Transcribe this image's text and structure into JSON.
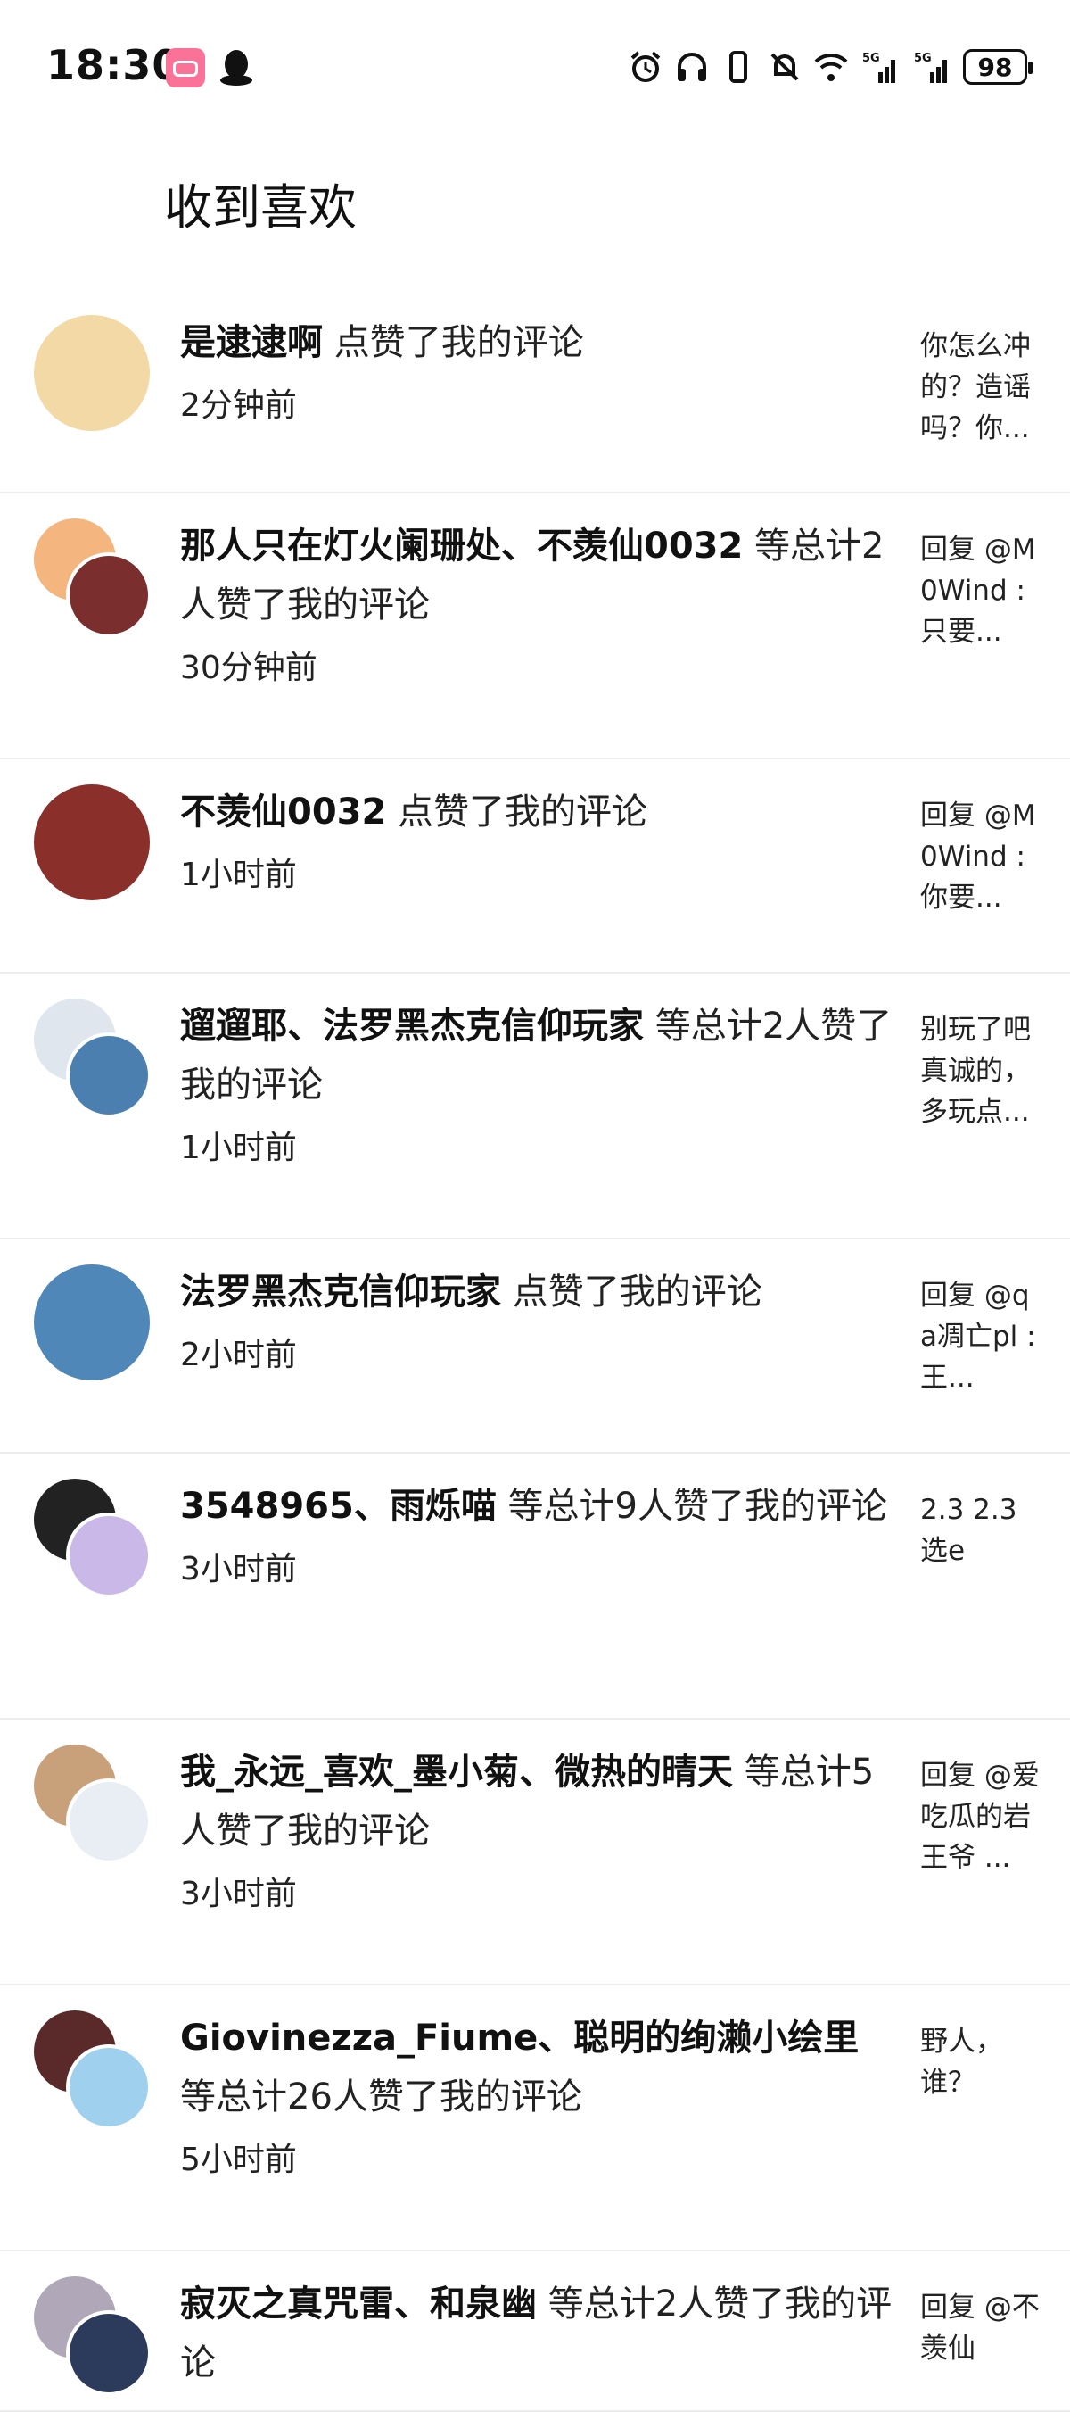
{
  "status_bar": {
    "time": "18:30",
    "battery": "98",
    "network": "5G",
    "icons": [
      "bilibili-icon",
      "qq-icon",
      "alarm-icon",
      "headphones-icon",
      "vibrate-icon",
      "mute-icon",
      "wifi-icon",
      "signal-icon"
    ]
  },
  "page": {
    "title": "收到喜欢"
  },
  "items": [
    {
      "names": "是逮逮啊",
      "action": " 点赞了我的评论",
      "time": "2分钟前",
      "preview": "你怎么冲的？造谣吗？你...",
      "avatars": [
        "#f3d9a5"
      ]
    },
    {
      "names": "那人只在灯火阑珊处、不羡仙0032",
      "action": " 等总计2人赞了我的评论",
      "time": "30分钟前",
      "preview": "回复 @M0Wind :只要...",
      "avatars": [
        "#f5b57e",
        "#7a2e2e"
      ]
    },
    {
      "names": "不羡仙0032",
      "action": " 点赞了我的评论",
      "time": "1小时前",
      "preview": "回复 @M0Wind :你要...",
      "avatars": [
        "#8b2f2a"
      ]
    },
    {
      "names": "遛遛耶、法罗黑杰克信仰玩家",
      "action": " 等总计2人赞了我的评论",
      "time": "1小时前",
      "preview": "别玩了吧真诚的，多玩点...",
      "avatars": [
        "#dfe6ee",
        "#4a7fb0"
      ]
    },
    {
      "names": "法罗黑杰克信仰玩家",
      "action": " 点赞了我的评论",
      "time": "2小时前",
      "preview": "回复 @qa凋亡pl :王...",
      "avatars": [
        "#4f87b8"
      ]
    },
    {
      "names": "3548965、雨烁喵",
      "action": " 等总计9人赞了我的评论",
      "time": "3小时前",
      "preview": "2.3 2.3 选e",
      "avatars": [
        "#222222",
        "#c9b8e8"
      ]
    },
    {
      "names": "我_永远_喜欢_墨小菊、微热的晴天",
      "action": " 等总计5人赞了我的评论",
      "time": "3小时前",
      "preview": "回复 @爱吃瓜的岩王爷 ...",
      "avatars": [
        "#c8a07a",
        "#e9eef5"
      ]
    },
    {
      "names": "Giovinezza_Fiume、聪明的绚濑小绘里",
      "action": " 等总计26人赞了我的评论",
      "time": "5小时前",
      "preview": "野人，谁？",
      "avatars": [
        "#5a2a2a",
        "#9fd0ee"
      ]
    },
    {
      "names": "寂灭之真咒雷、和泉幽",
      "action": " 等总计2人赞了我的评论",
      "time": "",
      "preview": "回复 @不羡仙",
      "avatars": [
        "#b0a8b8",
        "#2c3a5c"
      ]
    }
  ]
}
